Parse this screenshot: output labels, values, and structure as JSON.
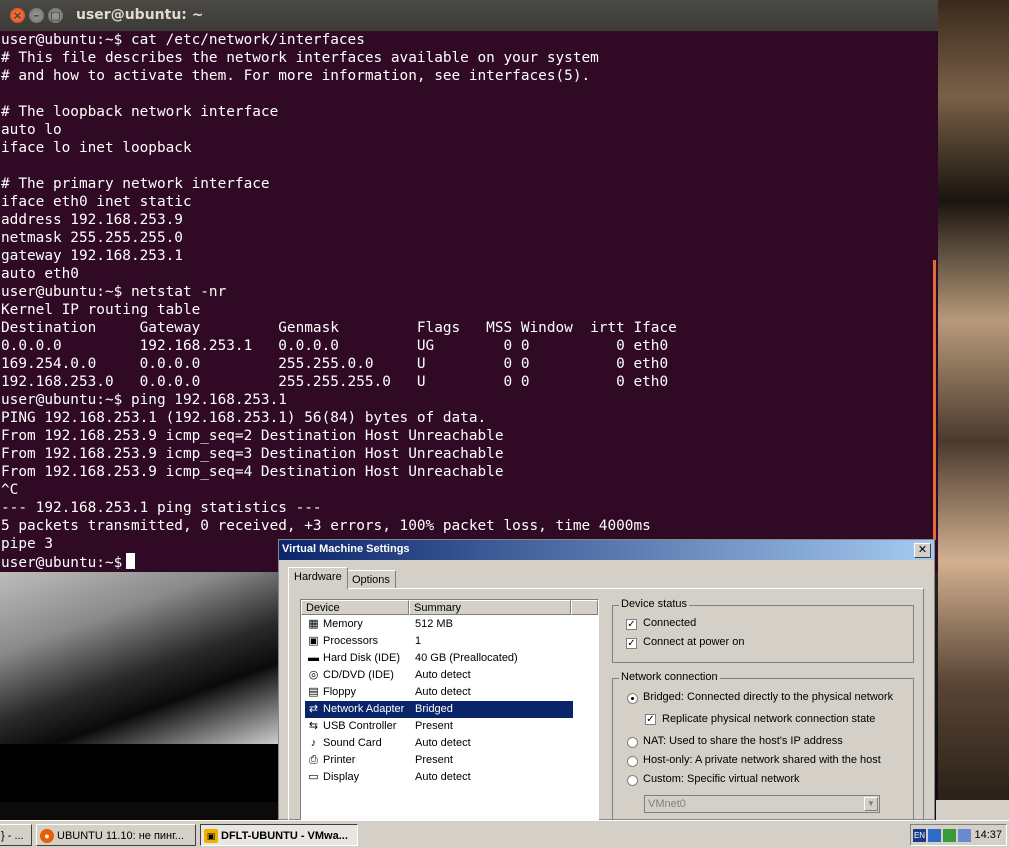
{
  "terminal": {
    "title": "user@ubuntu: ~",
    "lines": [
      "user@ubuntu:~$ cat /etc/network/interfaces",
      "# This file describes the network interfaces available on your system",
      "# and how to activate them. For more information, see interfaces(5).",
      "",
      "# The loopback network interface",
      "auto lo",
      "iface lo inet loopback",
      "",
      "# The primary network interface",
      "iface eth0 inet static",
      "address 192.168.253.9",
      "netmask 255.255.255.0",
      "gateway 192.168.253.1",
      "auto eth0",
      "user@ubuntu:~$ netstat -nr",
      "Kernel IP routing table",
      "Destination     Gateway         Genmask         Flags   MSS Window  irtt Iface",
      "0.0.0.0         192.168.253.1   0.0.0.0         UG        0 0          0 eth0",
      "169.254.0.0     0.0.0.0         255.255.0.0     U         0 0          0 eth0",
      "192.168.253.0   0.0.0.0         255.255.255.0   U         0 0          0 eth0",
      "user@ubuntu:~$ ping 192.168.253.1",
      "PING 192.168.253.1 (192.168.253.1) 56(84) bytes of data.",
      "From 192.168.253.9 icmp_seq=2 Destination Host Unreachable",
      "From 192.168.253.9 icmp_seq=3 Destination Host Unreachable",
      "From 192.168.253.9 icmp_seq=4 Destination Host Unreachable",
      "^C",
      "--- 192.168.253.1 ping statistics ---",
      "5 packets transmitted, 0 received, +3 errors, 100% packet loss, time 4000ms",
      "pipe 3"
    ],
    "prompt": "user@ubuntu:~$"
  },
  "dialog": {
    "title": "Virtual Machine Settings",
    "close": "✕",
    "tabs": [
      "Hardware",
      "Options"
    ],
    "columns": [
      "Device",
      "Summary"
    ],
    "devices": [
      {
        "icon": "▦",
        "name": "Memory",
        "summary": "512 MB"
      },
      {
        "icon": "▣",
        "name": "Processors",
        "summary": "1"
      },
      {
        "icon": "▬",
        "name": "Hard Disk (IDE)",
        "summary": "40 GB (Preallocated)"
      },
      {
        "icon": "◎",
        "name": "CD/DVD (IDE)",
        "summary": "Auto detect"
      },
      {
        "icon": "▤",
        "name": "Floppy",
        "summary": "Auto detect"
      },
      {
        "icon": "⇄",
        "name": "Network Adapter",
        "summary": "Bridged"
      },
      {
        "icon": "⇆",
        "name": "USB Controller",
        "summary": "Present"
      },
      {
        "icon": "♪",
        "name": "Sound Card",
        "summary": "Auto detect"
      },
      {
        "icon": "⎙",
        "name": "Printer",
        "summary": "Present"
      },
      {
        "icon": "▭",
        "name": "Display",
        "summary": "Auto detect"
      }
    ],
    "selected_device": "Network Adapter",
    "device_status": {
      "label": "Device status",
      "connected": "Connected",
      "connect_at_power_on": "Connect at power on"
    },
    "network_connection": {
      "label": "Network connection",
      "bridged": "Bridged: Connected directly to the physical network",
      "replicate": "Replicate physical network connection state",
      "nat": "NAT: Used to share the host's IP address",
      "host_only": "Host-only: A private network shared with the host",
      "custom": "Custom: Specific virtual network",
      "custom_value": "VMnet0",
      "checked_mark": "✓"
    }
  },
  "taskbar": {
    "items": [
      {
        "label": "} - ...",
        "icon": ""
      },
      {
        "label": "UBUNTU 11.10: не пинг...",
        "icon": "●"
      },
      {
        "label": "DFLT-UBUNTU - VMwa...",
        "icon": "▣"
      }
    ],
    "lang": "EN",
    "clock": "14:37"
  }
}
